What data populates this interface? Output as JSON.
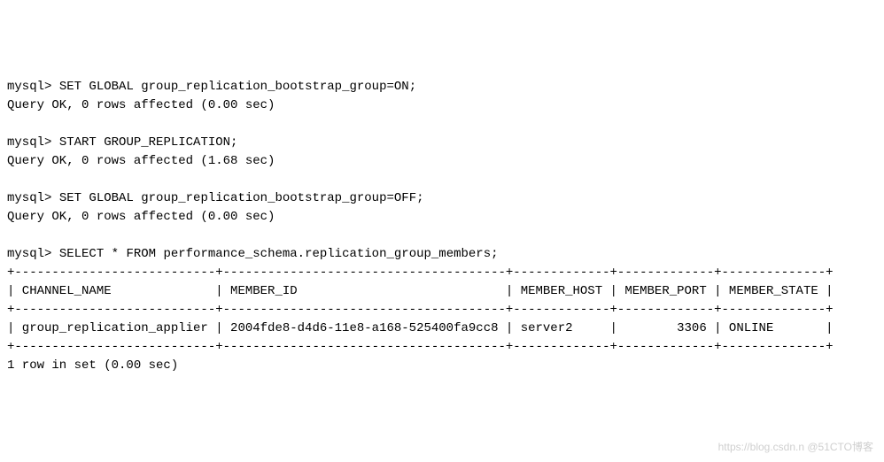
{
  "prompt": "mysql>",
  "commands": {
    "c1": "SET GLOBAL group_replication_bootstrap_group=ON;",
    "c2": "START GROUP_REPLICATION;",
    "c3": "SET GLOBAL group_replication_bootstrap_group=OFF;",
    "c4": "SELECT * FROM performance_schema.replication_group_members;"
  },
  "responses": {
    "r1": "Query OK, 0 rows affected (0.00 sec)",
    "r2": "Query OK, 0 rows affected (1.68 sec)",
    "r3": "Query OK, 0 rows affected (0.00 sec)"
  },
  "table": {
    "border_top": "+---------------------------+--------------------------------------+-------------+-------------+--------------+",
    "header_line": "| CHANNEL_NAME              | MEMBER_ID                            | MEMBER_HOST | MEMBER_PORT | MEMBER_STATE |",
    "border_mid": "+---------------------------+--------------------------------------+-------------+-------------+--------------+",
    "row_line": "| group_replication_applier | 2004fde8-d4d6-11e8-a168-525400fa9cc8 | server2     |        3306 | ONLINE       |",
    "border_bot": "+---------------------------+--------------------------------------+-------------+-------------+--------------+",
    "footer": "1 row in set (0.00 sec)",
    "columns": [
      "CHANNEL_NAME",
      "MEMBER_ID",
      "MEMBER_HOST",
      "MEMBER_PORT",
      "MEMBER_STATE"
    ],
    "rows": [
      {
        "CHANNEL_NAME": "group_replication_applier",
        "MEMBER_ID": "2004fde8-d4d6-11e8-a168-525400fa9cc8",
        "MEMBER_HOST": "server2",
        "MEMBER_PORT": 3306,
        "MEMBER_STATE": "ONLINE"
      }
    ]
  },
  "watermark": "https://blog.csdn.n @51CTO博客"
}
